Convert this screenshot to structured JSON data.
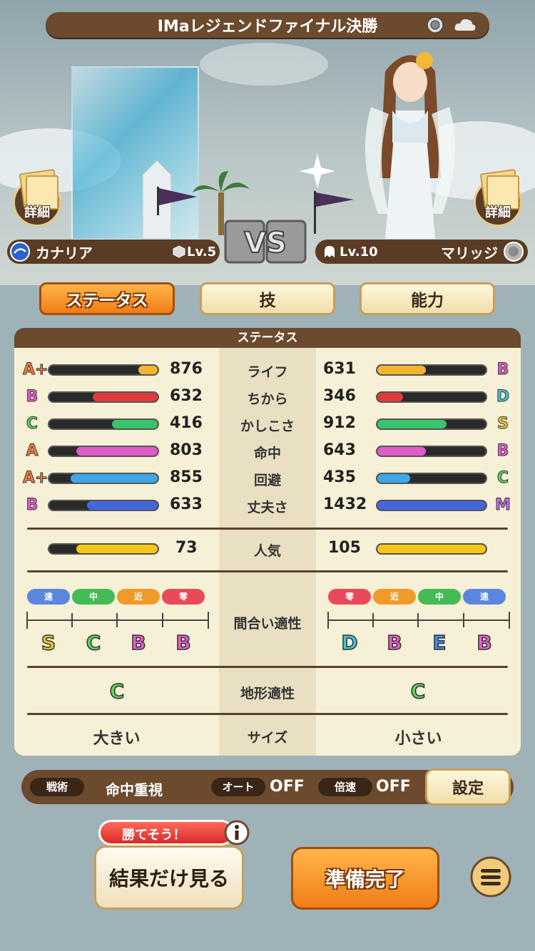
{
  "title": "IMaレジェンドファイナル決勝",
  "top_icons": [
    "target-circle-icon",
    "cloud-icon"
  ],
  "detail_label": "詳細",
  "left_unit": {
    "name": "カナリア",
    "level": "Lv.5"
  },
  "right_unit": {
    "name": "マリッジ",
    "level": "Lv.10"
  },
  "vs_text": "VS",
  "tabs": [
    {
      "label": "ステータス",
      "active": true
    },
    {
      "label": "技",
      "active": false
    },
    {
      "label": "能力",
      "active": false
    }
  ],
  "panel_title": "ステータス",
  "stats": [
    {
      "name": "ライフ",
      "l_rank": "A+",
      "l_val": "876",
      "l_frac": 0.18,
      "l_color": "#f5b52f",
      "r_rank": "B",
      "r_val": "631",
      "r_frac": 0.45,
      "r_color": "#f5b52f"
    },
    {
      "name": "ちから",
      "l_rank": "B",
      "l_val": "632",
      "l_frac": 0.6,
      "l_color": "#e03a3a",
      "r_rank": "D",
      "r_val": "346",
      "r_frac": 0.24,
      "r_color": "#e03a3a"
    },
    {
      "name": "かしこさ",
      "l_rank": "C",
      "l_val": "416",
      "l_frac": 0.42,
      "l_color": "#38c46b",
      "r_rank": "S",
      "r_val": "912",
      "r_frac": 0.64,
      "r_color": "#38c46b"
    },
    {
      "name": "命中",
      "l_rank": "A",
      "l_val": "803",
      "l_frac": 0.75,
      "l_color": "#df5bc9",
      "r_rank": "B",
      "r_val": "643",
      "r_frac": 0.45,
      "r_color": "#df5bc9"
    },
    {
      "name": "回避",
      "l_rank": "A+",
      "l_val": "855",
      "l_frac": 0.8,
      "l_color": "#3fa7e8",
      "r_rank": "C",
      "r_val": "435",
      "r_frac": 0.3,
      "r_color": "#3fa7e8"
    },
    {
      "name": "丈夫さ",
      "l_rank": "B",
      "l_val": "633",
      "l_frac": 0.65,
      "l_color": "#4466dd",
      "r_rank": "M",
      "r_val": "1432",
      "r_frac": 1.0,
      "r_color": "#4466dd"
    }
  ],
  "popularity": {
    "name": "人気",
    "l_val": "73",
    "l_frac": 0.75,
    "r_val": "105",
    "r_frac": 1.0,
    "color": "#f5c518"
  },
  "range_label": "間合い適性",
  "ranges_left": [
    {
      "pill": "遠",
      "color": "#5a86e0",
      "grade": "S"
    },
    {
      "pill": "中",
      "color": "#44bb55",
      "grade": "C"
    },
    {
      "pill": "近",
      "color": "#f09a2a",
      "grade": "B"
    },
    {
      "pill": "零",
      "color": "#e84a5a",
      "grade": "B"
    }
  ],
  "ranges_right": [
    {
      "pill": "零",
      "color": "#e84a5a",
      "grade": "D"
    },
    {
      "pill": "近",
      "color": "#f09a2a",
      "grade": "B"
    },
    {
      "pill": "中",
      "color": "#44bb55",
      "grade": "E"
    },
    {
      "pill": "遠",
      "color": "#5a86e0",
      "grade": "B"
    }
  ],
  "terrain": {
    "name": "地形適性",
    "l_grade": "C",
    "r_grade": "C"
  },
  "size": {
    "name": "サイズ",
    "l_val": "大きい",
    "r_val": "小さい"
  },
  "footer": {
    "tactics_label": "戦術",
    "tactics_value": "命中重視",
    "auto_label": "オート",
    "auto_value": "OFF",
    "speed_label": "倍速",
    "speed_value": "OFF",
    "settings_label": "設定"
  },
  "hint_badge": "勝てそう！",
  "result_button": "結果だけ見る",
  "ready_button": "準備完了",
  "colors": {
    "brown": "#6b4a2e",
    "orange": "#f07d16",
    "cream": "#f6f1d6"
  }
}
